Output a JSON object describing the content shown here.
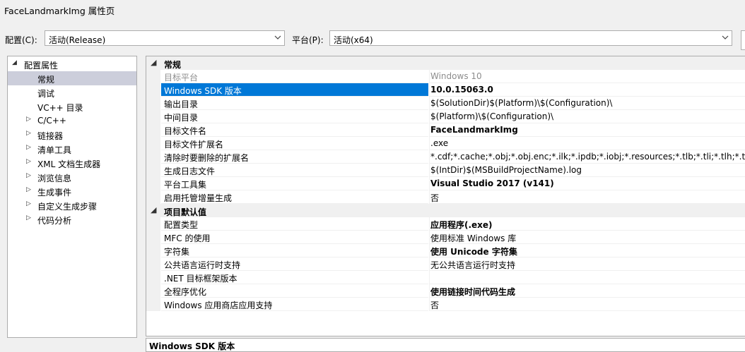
{
  "window": {
    "title": "FaceLandmarkImg 属性页"
  },
  "config_bar": {
    "config_label": "配置(C):",
    "config_value": "活动(Release)",
    "platform_label": "平台(P):",
    "platform_value": "活动(x64)"
  },
  "tree": {
    "root": "配置属性",
    "items": [
      {
        "label": "常规",
        "selected": true,
        "expander": ""
      },
      {
        "label": "调试",
        "expander": ""
      },
      {
        "label": "VC++ 目录",
        "expander": ""
      },
      {
        "label": "C/C++",
        "expander": "▷"
      },
      {
        "label": "链接器",
        "expander": "▷"
      },
      {
        "label": "清单工具",
        "expander": "▷"
      },
      {
        "label": "XML 文档生成器",
        "expander": "▷"
      },
      {
        "label": "浏览信息",
        "expander": "▷"
      },
      {
        "label": "生成事件",
        "expander": "▷"
      },
      {
        "label": "自定义生成步骤",
        "expander": "▷"
      },
      {
        "label": "代码分析",
        "expander": "▷"
      }
    ],
    "root_expander": "◢"
  },
  "grid": {
    "category1": "常规",
    "category2": "项目默认值",
    "general": [
      {
        "name": "目标平台",
        "value": "Windows 10"
      },
      {
        "name": "Windows SDK 版本",
        "value": "10.0.15063.0"
      },
      {
        "name": "输出目录",
        "value": "$(SolutionDir)$(Platform)\\$(Configuration)\\"
      },
      {
        "name": "中间目录",
        "value": "$(Platform)\\$(Configuration)\\"
      },
      {
        "name": "目标文件名",
        "value": "FaceLandmarkImg"
      },
      {
        "name": "目标文件扩展名",
        "value": ".exe"
      },
      {
        "name": "清除时要删除的扩展名",
        "value": "*.cdf;*.cache;*.obj;*.obj.enc;*.ilk;*.ipdb;*.iobj;*.resources;*.tlb;*.tli;*.tlh;*.tmp;*.rsp"
      },
      {
        "name": "生成日志文件",
        "value": "$(IntDir)$(MSBuildProjectName).log"
      },
      {
        "name": "平台工具集",
        "value": "Visual Studio 2017 (v141)"
      },
      {
        "name": "启用托管增量生成",
        "value": "否"
      }
    ],
    "defaults": [
      {
        "name": "配置类型",
        "value": "应用程序(.exe)"
      },
      {
        "name": "MFC 的使用",
        "value": "使用标准 Windows 库"
      },
      {
        "name": "字符集",
        "value": "使用 Unicode 字符集"
      },
      {
        "name": "公共语言运行时支持",
        "value": "无公共语言运行时支持"
      },
      {
        "name": ".NET 目标框架版本",
        "value": ""
      },
      {
        "name": "全程序优化",
        "value": "使用链接时间代码生成"
      },
      {
        "name": "Windows 应用商店应用支持",
        "value": "否"
      }
    ],
    "category_expander": "◢"
  },
  "description": {
    "title": "Windows SDK 版本"
  },
  "icons": {
    "dropdown": "chevron-down-icon"
  }
}
